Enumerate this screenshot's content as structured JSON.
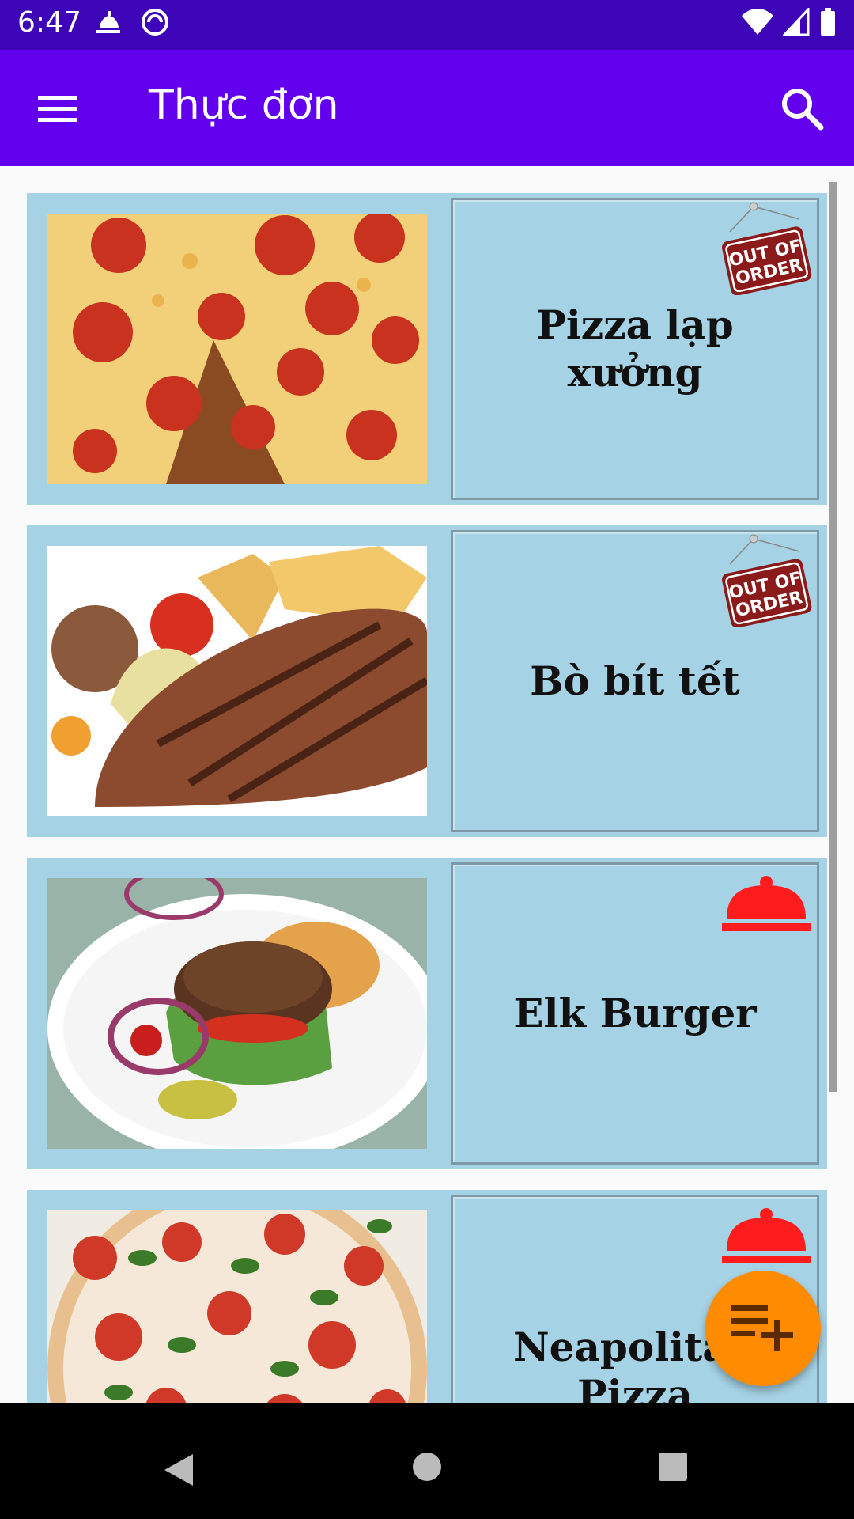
{
  "status_bar": {
    "time": "6:47",
    "left_icons": [
      "food-notification-icon",
      "sync-icon"
    ],
    "right_icons": [
      "wifi-icon",
      "signal-icon",
      "battery-icon"
    ]
  },
  "app_bar": {
    "title": "Thực đơn",
    "menu_icon": "hamburger-menu-icon",
    "search_icon": "search-icon",
    "color": "#6200ee"
  },
  "menu_items": [
    {
      "name": "Pizza lạp xưởng",
      "status_badge": "out-of-order",
      "badge_text": "OUT OF ORDER",
      "photo": "pepperoni-pizza"
    },
    {
      "name": "Bò bít tết",
      "status_badge": "out-of-order",
      "badge_text": "OUT OF ORDER",
      "photo": "steak"
    },
    {
      "name": "Elk Burger",
      "status_badge": "available",
      "badge_text": "",
      "photo": "burger"
    },
    {
      "name": "Neapolitan Pizza",
      "status_badge": "available",
      "badge_text": "",
      "photo": "neapolitan-pizza"
    }
  ],
  "fab": {
    "icon": "playlist-add-icon",
    "color": "#ff8c00"
  },
  "nav_bar": {
    "buttons": [
      "back-icon",
      "home-icon",
      "recents-icon"
    ]
  },
  "colors": {
    "card": "#a5d2e4",
    "badge_out_of_order": "#8b1a1a",
    "badge_available": "#ff1c1c"
  }
}
